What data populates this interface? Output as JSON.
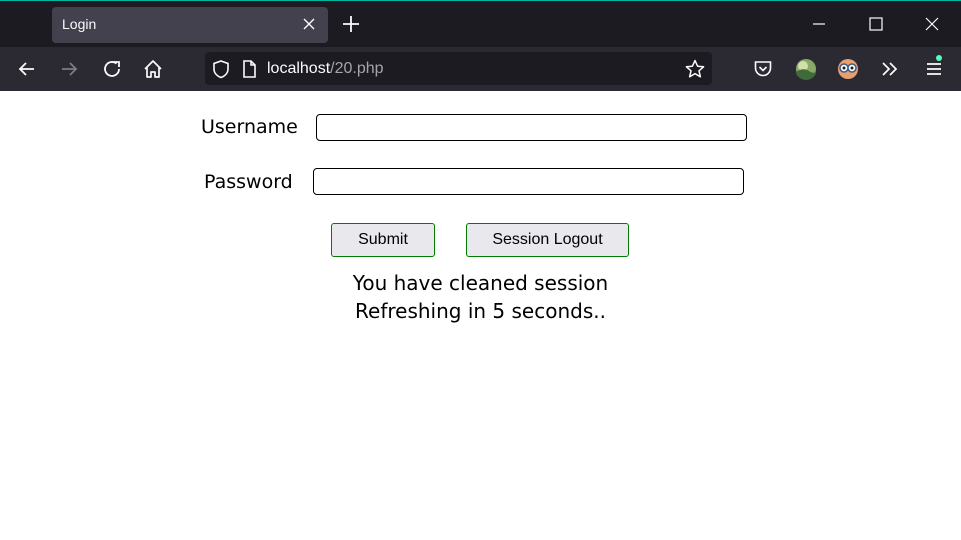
{
  "browser": {
    "tab_title": "Login",
    "url_host": "localhost",
    "url_path": "/20.php",
    "accent_color": "#00b3a4"
  },
  "icons": {
    "tab_close": "close-icon",
    "new_tab": "plus-icon",
    "back": "back-arrow-icon",
    "forward": "forward-arrow-icon",
    "reload": "reload-icon",
    "home": "home-icon",
    "shield": "shield-icon",
    "page": "page-icon",
    "bookmark": "star-icon",
    "pocket": "pocket-icon",
    "overflow": "double-chevron-icon",
    "menu": "hamburger-icon"
  },
  "form": {
    "username_label": "Username",
    "username_value": "",
    "password_label": "Password",
    "password_value": "",
    "submit_label": "Submit",
    "logout_label": "Session Logout"
  },
  "status": {
    "line1": "You have cleaned session",
    "line2": "Refreshing in 5 seconds.."
  }
}
